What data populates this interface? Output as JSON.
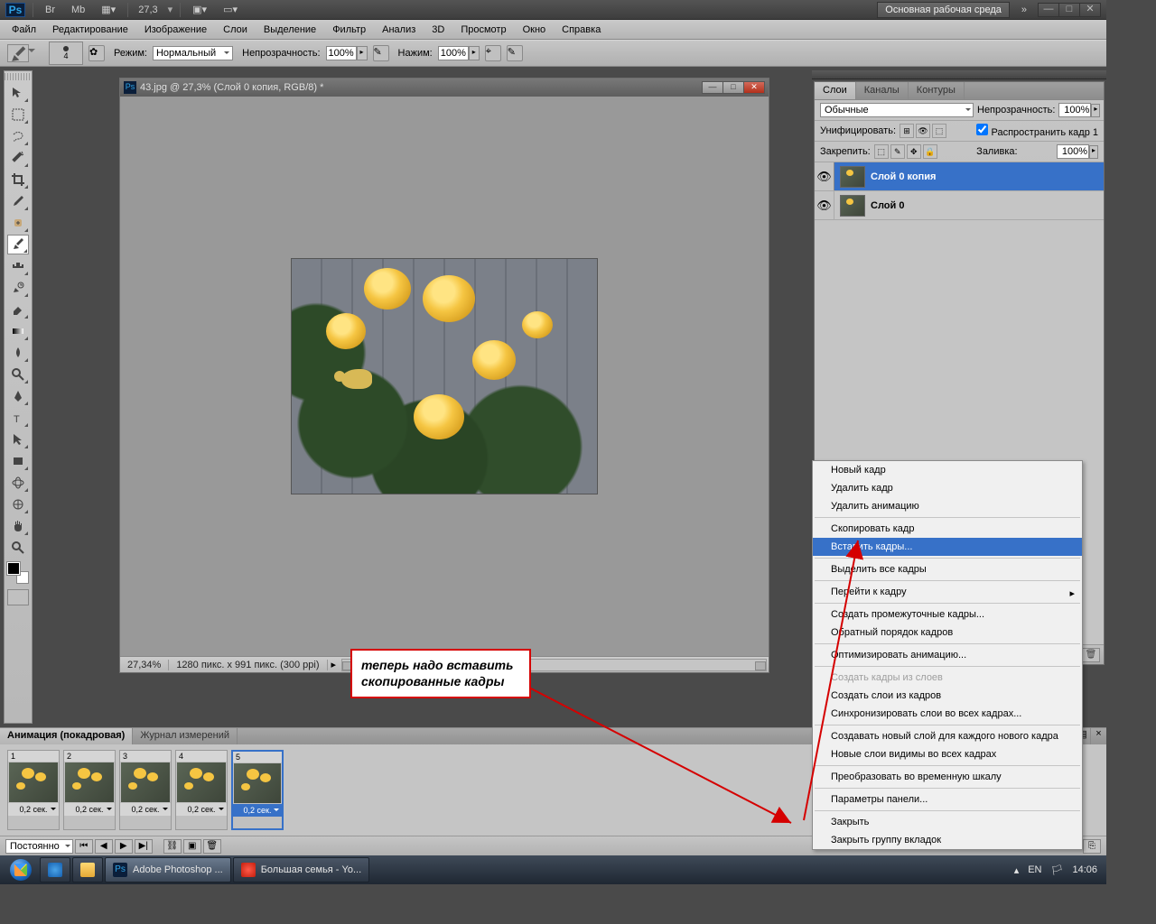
{
  "topbar": {
    "zoom": "27,3",
    "workspace": "Основная рабочая среда"
  },
  "menubar": [
    "Файл",
    "Редактирование",
    "Изображение",
    "Слои",
    "Выделение",
    "Фильтр",
    "Анализ",
    "3D",
    "Просмотр",
    "Окно",
    "Справка"
  ],
  "options": {
    "brush_size": "4",
    "mode_label": "Режим:",
    "mode_value": "Нормальный",
    "opacity_label": "Непрозрачность:",
    "opacity_value": "100%",
    "flow_label": "Нажим:",
    "flow_value": "100%"
  },
  "document": {
    "title": "43.jpg @ 27,3% (Слой 0 копия, RGB/8) *",
    "status_zoom": "27,34%",
    "status_info": "1280 пикс. x 991 пикс. (300 ppi)"
  },
  "layers_panel": {
    "tabs": [
      "Слои",
      "Каналы",
      "Контуры"
    ],
    "blend_mode": "Обычные",
    "opacity_label": "Непрозрачность:",
    "opacity_value": "100%",
    "unify_label": "Унифицировать:",
    "propagate_label": "Распространить кадр 1",
    "lock_label": "Закрепить:",
    "fill_label": "Заливка:",
    "fill_value": "100%",
    "layers": [
      {
        "name": "Слой 0 копия",
        "selected": true
      },
      {
        "name": "Слой 0",
        "selected": false
      }
    ]
  },
  "context_menu": {
    "groups": [
      [
        "Новый кадр",
        "Удалить кадр",
        "Удалить анимацию"
      ],
      [
        "Скопировать кадр",
        {
          "label": "Вставить кадры...",
          "highlighted": true
        }
      ],
      [
        "Выделить все кадры"
      ],
      [
        {
          "label": "Перейти к кадру",
          "submenu": true
        }
      ],
      [
        "Создать промежуточные кадры...",
        "Обратный порядок кадров"
      ],
      [
        "Оптимизировать анимацию..."
      ],
      [
        {
          "label": "Создать кадры из слоев",
          "disabled": true
        },
        "Создать слои из кадров",
        "Синхронизировать слои во всех кадрах..."
      ],
      [
        "Создавать новый слой для каждого нового кадра",
        "Новые слои видимы во всех кадрах"
      ],
      [
        "Преобразовать во временную шкалу"
      ],
      [
        "Параметры панели..."
      ],
      [
        "Закрыть",
        "Закрыть группу вкладок"
      ]
    ]
  },
  "annotation": "теперь надо вставить скопированные кадры",
  "animation": {
    "tabs": [
      "Анимация (покадровая)",
      "Журнал измерений"
    ],
    "frames": [
      {
        "n": "1",
        "time": "0,2 сек."
      },
      {
        "n": "2",
        "time": "0,2 сек."
      },
      {
        "n": "3",
        "time": "0,2 сек."
      },
      {
        "n": "4",
        "time": "0,2 сек."
      },
      {
        "n": "5",
        "time": "0,2 сек.",
        "selected": true
      }
    ],
    "loop": "Постоянно"
  },
  "taskbar": {
    "apps": [
      {
        "label": "Adobe Photoshop ...",
        "icon": "ps",
        "active": true
      },
      {
        "label": "Большая семья - Yo...",
        "icon": "opera"
      }
    ],
    "lang": "EN",
    "time": "14:06"
  }
}
